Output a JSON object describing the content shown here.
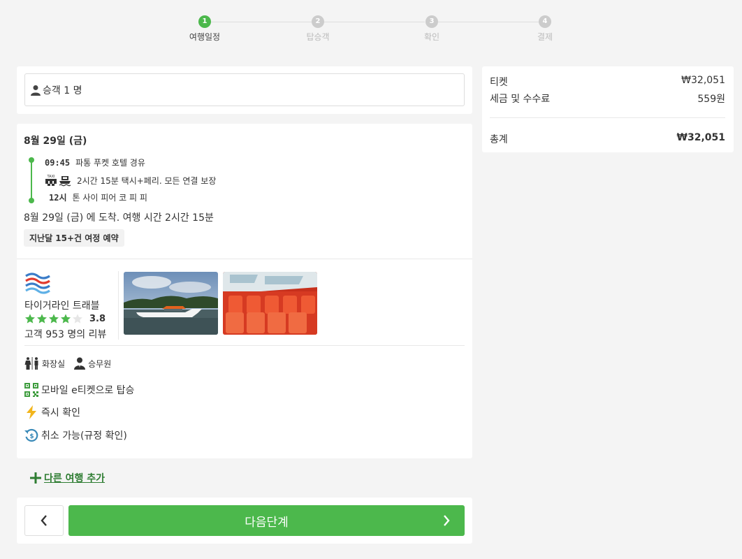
{
  "stepper": {
    "steps": [
      {
        "num": "1",
        "label": "여행일정"
      },
      {
        "num": "2",
        "label": "탑승객"
      },
      {
        "num": "3",
        "label": "확인"
      },
      {
        "num": "4",
        "label": "결제"
      }
    ]
  },
  "passengers": {
    "label": "승객 1 명"
  },
  "trip": {
    "date": "8월 29일 (금)",
    "depart_time": "09:45",
    "depart_place": "파통 푸켓 호텔 경유",
    "transport_desc": "2시간 15분 택시+페리. 모든 연결 보장",
    "taxi_label": "TAXI",
    "arrive_time": "12시",
    "arrive_place": "톤 사이 피어 코 피 피",
    "arrival_summary": "8월 29일 (금) 에 도착. 여행 시간 2시간 15분",
    "badge": "지난달 15+건 여정 예약"
  },
  "operator": {
    "name": "타이거라인 트래블",
    "rating": "3.8",
    "rating_value": 3.8,
    "rating_max": 5,
    "reviews": "고객 953 명의 리뷰"
  },
  "amenities": [
    "화장실",
    "승무원"
  ],
  "features": [
    "모바일 e티켓으로 탑승",
    "즉시 확인",
    "취소 가능(규정 확인)"
  ],
  "add_trip": "다른 여행 추가",
  "nav": {
    "next": "다음단계"
  },
  "summary": {
    "ticket_label": "티켓",
    "ticket_value": "₩32,051",
    "fee_label": "세금 및 수수료",
    "fee_value": "559원",
    "total_label": "총계",
    "total_value": "₩32,051"
  },
  "colors": {
    "accent": "#4cb84c",
    "link": "#2e7d32"
  }
}
